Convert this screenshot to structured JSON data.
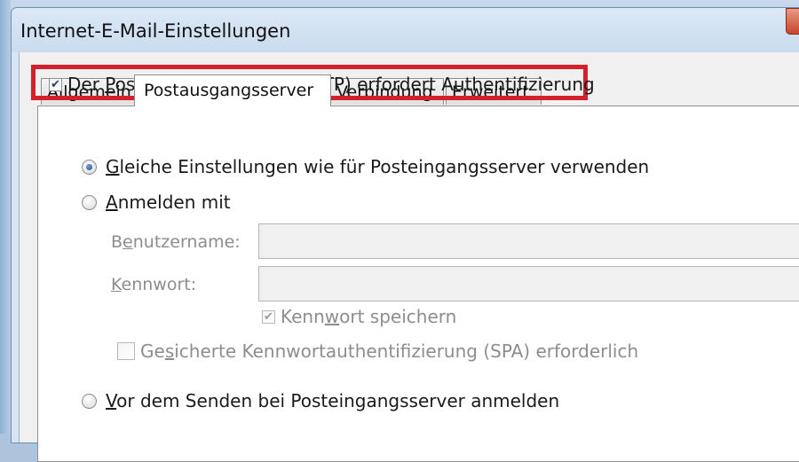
{
  "window": {
    "title": "Internet-E-Mail-Einstellungen"
  },
  "tabs": [
    {
      "label": "Allgemein"
    },
    {
      "label": "Postausgangsserver",
      "active": true
    },
    {
      "label": "Verbindung"
    },
    {
      "label": "Erweitert"
    }
  ],
  "smtp_auth": {
    "pre": "Der ",
    "accel": "P",
    "post": "ostausgangsserver (SMTP) erfordert Authentifizierung",
    "checked": true
  },
  "same_settings": {
    "accel": "G",
    "post": "leiche Einstellungen wie für Posteingangsserver verwenden",
    "selected": true
  },
  "login_with": {
    "accel": "A",
    "post": "nmelden mit",
    "selected": false
  },
  "username": {
    "pre": "B",
    "accel": "e",
    "post": "nutzername:",
    "value": ""
  },
  "password": {
    "accel": "K",
    "post": "ennwort:",
    "value": ""
  },
  "save_password": {
    "pre": "Kenn",
    "accel": "w",
    "post": "ort speichern",
    "checked": true,
    "disabled": true
  },
  "spa": {
    "pre": "Ge",
    "accel": "s",
    "post": "icherte Kennwortauthentifizierung (SPA) erforderlich",
    "checked": false,
    "disabled": true
  },
  "login_before_send": {
    "accel": "V",
    "post": "or dem Senden bei Posteingangsserver anmelden",
    "selected": false
  },
  "colors": {
    "highlight": "#d3202a",
    "window_frame": "#d7e4f2",
    "close_button": "#c7452c"
  },
  "icons": {
    "checked": "checkmark-icon"
  }
}
